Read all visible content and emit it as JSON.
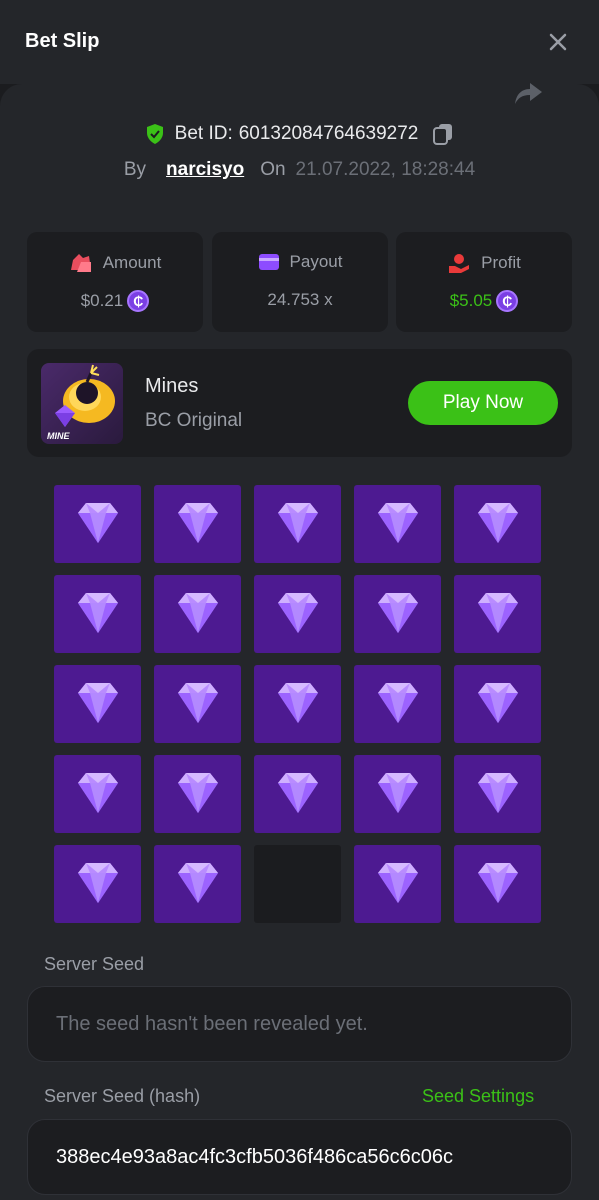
{
  "header": {
    "title": "Bet Slip"
  },
  "bet": {
    "id_label": "Bet ID:",
    "id_value": "60132084764639272",
    "by_label": "By",
    "username": "narcisyo",
    "on_label": "On",
    "date": "21.07.2022, 18:28:44"
  },
  "stats": [
    {
      "label": "Amount",
      "value": "$0.21",
      "icon": "money-bag-icon",
      "color": "#e94e5e",
      "coin": true
    },
    {
      "label": "Payout",
      "value": "24.753 x",
      "icon": "wallet-card-icon",
      "color": "#8d4cff",
      "coin": false
    },
    {
      "label": "Profit",
      "value": "$5.05",
      "icon": "profit-hand-icon",
      "color": "#e93a3a",
      "coin": true
    }
  ],
  "game": {
    "name": "Mines",
    "provider": "BC Original",
    "thumb_label": "MINE",
    "play_label": "Play Now"
  },
  "grid": {
    "rows": 5,
    "cols": 5,
    "tiles": [
      "gem",
      "gem",
      "gem",
      "gem",
      "gem",
      "gem",
      "gem",
      "gem",
      "gem",
      "gem",
      "gem",
      "gem",
      "gem",
      "gem",
      "gem",
      "gem",
      "gem",
      "gem",
      "gem",
      "gem",
      "gem",
      "gem",
      "empty",
      "gem",
      "gem"
    ]
  },
  "seed": {
    "server_label": "Server Seed",
    "server_placeholder": "The seed hasn't been revealed yet.",
    "hash_label": "Server Seed (hash)",
    "settings_label": "Seed Settings",
    "hash_value": "388ec4e93a8ac4fc3cfb5036f486ca56c6c06c"
  },
  "colors": {
    "accent_green": "#3bc117",
    "tile_purple": "#4d1a91",
    "coin_purple": "#7b3fe4"
  }
}
